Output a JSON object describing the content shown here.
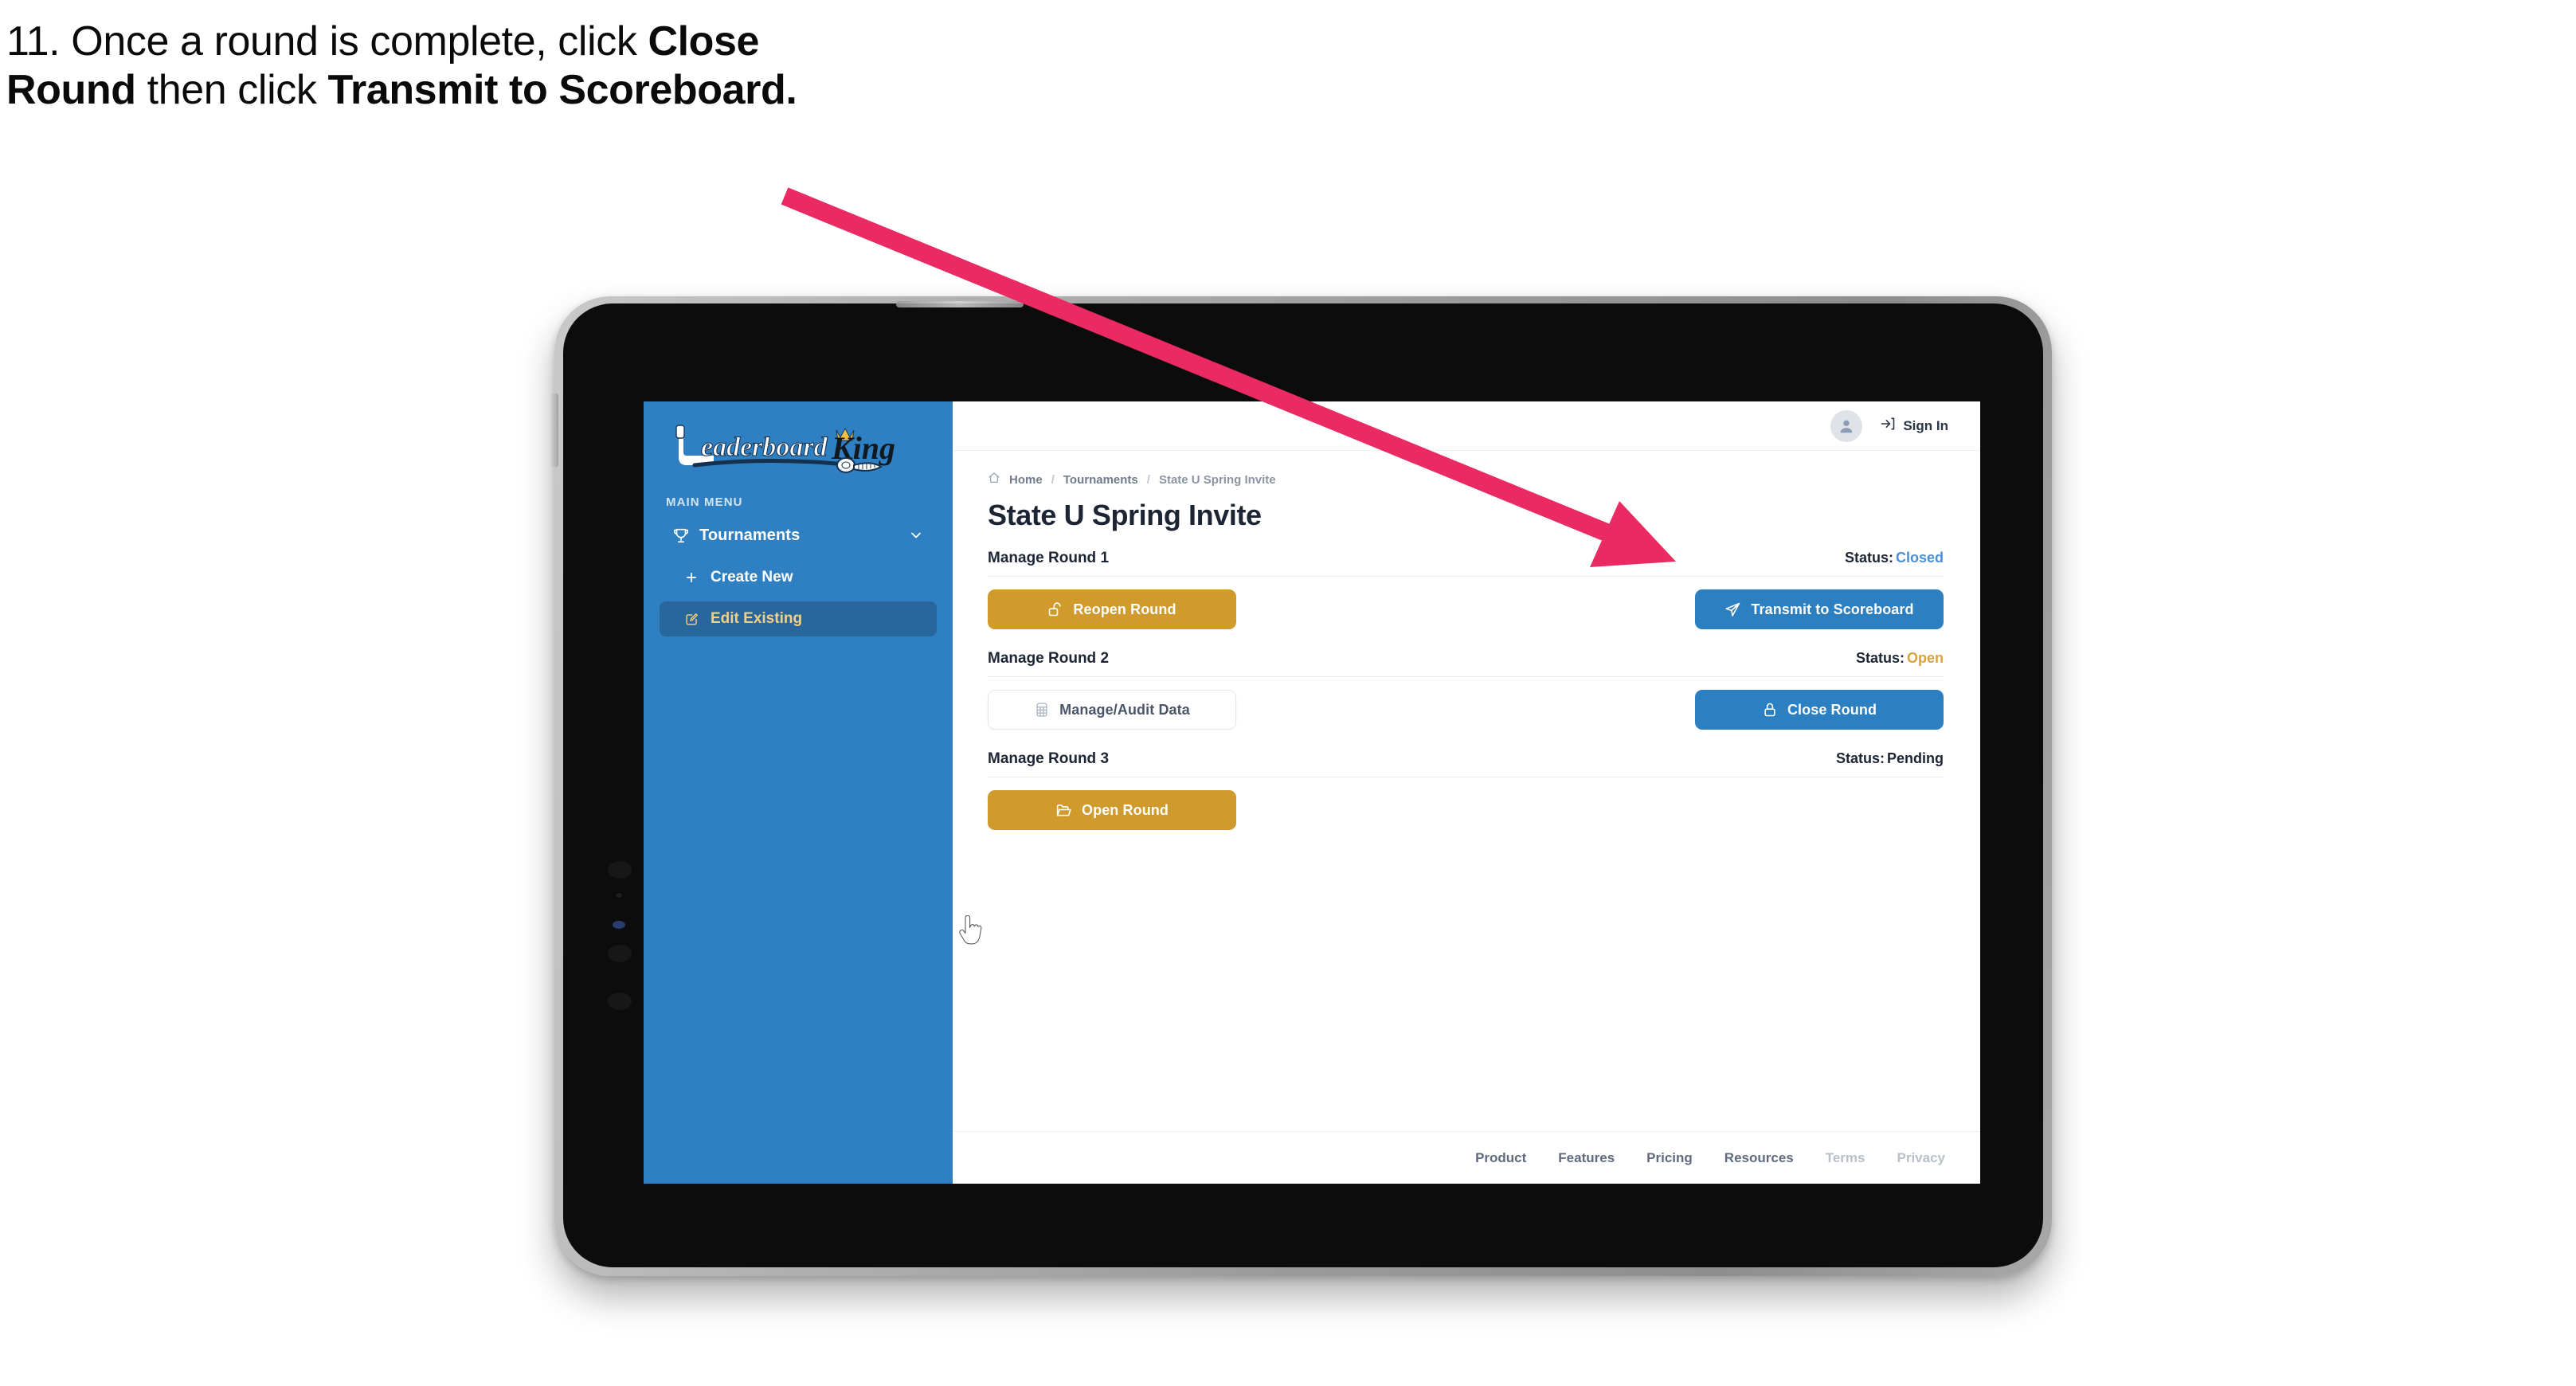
{
  "annotation": {
    "step_number": "11.",
    "line1": "11. Once a round is complete,",
    "text_pre": "11. Once a round is complete, click ",
    "bold1": "Close Round",
    "text_mid": " then click ",
    "bold2": "Transmit to Scoreboard.",
    "arrow_color": "#ea2a63"
  },
  "app": {
    "brand": {
      "name_part1": "Leaderboard",
      "name_part2": "King",
      "icon": "golf-putter-logo-icon"
    },
    "sidebar": {
      "section_label": "MAIN MENU",
      "accent_bg": "#2f80c2",
      "active_bg": "#27679c",
      "active_text": "#f3d08a",
      "items": [
        {
          "label": "Tournaments",
          "icon": "trophy-icon",
          "trailing_icon": "chevron-down-icon",
          "active": false
        },
        {
          "label": "Create New",
          "icon": "plus-icon",
          "active": false
        },
        {
          "label": "Edit Existing",
          "icon": "edit-square-icon",
          "active": true
        }
      ]
    },
    "topbar": {
      "avatar_icon": "user-avatar-icon",
      "signin_label": "Sign In",
      "signin_icon": "sign-in-arrow-icon"
    },
    "breadcrumb": {
      "home_icon": "home-icon",
      "items": [
        "Home",
        "Tournaments",
        "State U Spring Invite"
      ],
      "separator": "/"
    },
    "page_title": "State U Spring Invite",
    "status_label": "Status:",
    "status_colors": {
      "closed": "#4a8fd4",
      "open": "#d9a23c",
      "pending": "#1d2535"
    },
    "rounds": [
      {
        "title": "Manage Round 1",
        "status_label": "Status:",
        "status_value": "Closed",
        "status_color": "#4a8fd4",
        "left_button": {
          "label": "Reopen Round",
          "icon": "unlock-icon",
          "style": "gold"
        },
        "right_button": {
          "label": "Transmit to Scoreboard",
          "icon": "send-paper-plane-icon",
          "style": "blue"
        }
      },
      {
        "title": "Manage Round 2",
        "status_label": "Status:",
        "status_value": "Open",
        "status_color": "#d9a23c",
        "left_button": {
          "label": "Manage/Audit Data",
          "icon": "table-grid-icon",
          "style": "ghost"
        },
        "right_button": {
          "label": "Close Round",
          "icon": "lock-icon",
          "style": "blue"
        }
      },
      {
        "title": "Manage Round 3",
        "status_label": "Status:",
        "status_value": "Pending",
        "status_color": "#1d2535",
        "left_button": {
          "label": "Open Round",
          "icon": "open-folder-icon",
          "style": "gold"
        },
        "right_button": null
      }
    ],
    "footer": {
      "links": [
        {
          "label": "Product",
          "muted": false
        },
        {
          "label": "Features",
          "muted": false
        },
        {
          "label": "Pricing",
          "muted": false
        },
        {
          "label": "Resources",
          "muted": false
        },
        {
          "label": "Terms",
          "muted": true
        },
        {
          "label": "Privacy",
          "muted": true
        }
      ]
    },
    "cursor": {
      "icon": "pointer-hand-cursor"
    }
  },
  "device": {
    "type": "tablet-mockup"
  }
}
